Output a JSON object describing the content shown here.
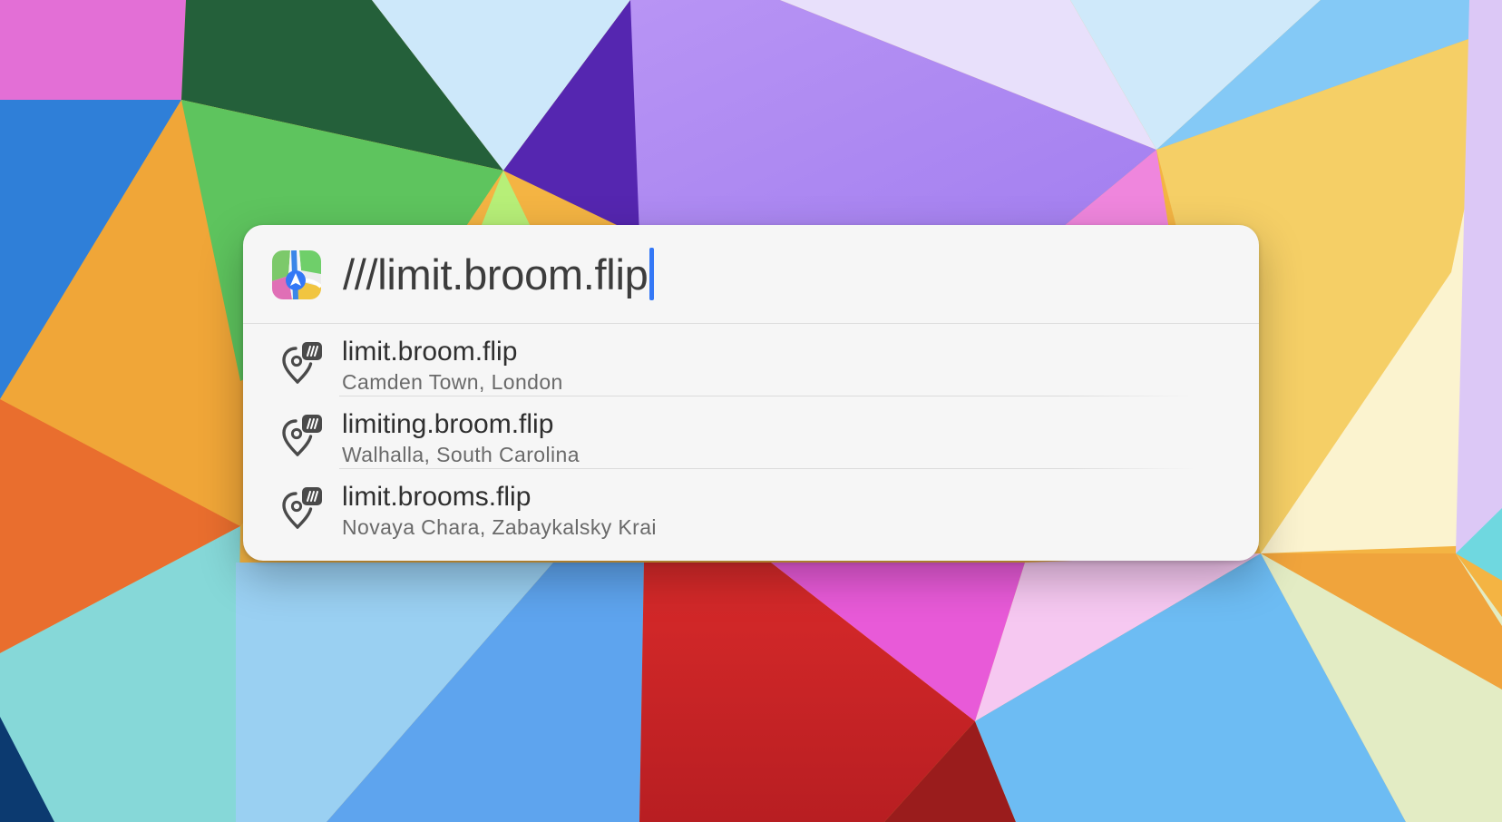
{
  "search": {
    "value": "///limit.broom.flip",
    "app_icon": "maps-app-icon"
  },
  "results": [
    {
      "title": "limit.broom.flip",
      "subtitle": "Camden Town, London",
      "icon": "what3words-pin-icon"
    },
    {
      "title": "limiting.broom.flip",
      "subtitle": "Walhalla, South Carolina",
      "icon": "what3words-pin-icon"
    },
    {
      "title": "limit.brooms.flip",
      "subtitle": "Novaya Chara, Zabaykalsky Krai",
      "icon": "what3words-pin-icon"
    }
  ],
  "colors": {
    "panel_background": "#f6f6f6",
    "caret": "#3478f6",
    "title_text": "#2f2f2f",
    "subtitle_text": "#6a6a6a"
  }
}
